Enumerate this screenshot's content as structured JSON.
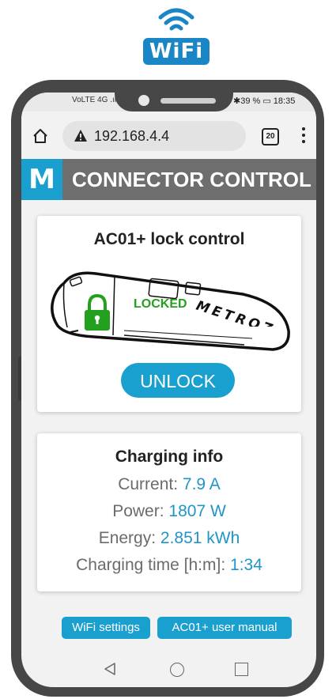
{
  "wifi_logo": {
    "text": "WiFi"
  },
  "status_bar": {
    "left": "VoLTE 4G .ıl ≈",
    "right": "✱39 % ▭ 18:35"
  },
  "browser": {
    "url": "192.168.4.4",
    "tab_count": "20"
  },
  "header": {
    "logo_letter": "M",
    "title": "CONNECTOR CONTROL"
  },
  "lock_card": {
    "title": "AC01+ lock control",
    "status": "LOCKED",
    "brand": "METROZ",
    "unlock_label": "UNLOCK"
  },
  "charging_card": {
    "title": "Charging info",
    "rows": [
      {
        "label": "Current:",
        "value": "7.9 A"
      },
      {
        "label": "Power:",
        "value": "1807 W"
      },
      {
        "label": "Energy:",
        "value": "2.851 kWh"
      },
      {
        "label": "Charging time [h:m]:",
        "value": "1:34"
      }
    ]
  },
  "links": {
    "wifi_settings": "WiFi settings",
    "manual": "AC01+ user manual"
  },
  "colors": {
    "accent": "#1aa0cf",
    "header_bg": "#6e6e6e",
    "locked_green": "#23a01d",
    "phone_frame": "#474747"
  }
}
